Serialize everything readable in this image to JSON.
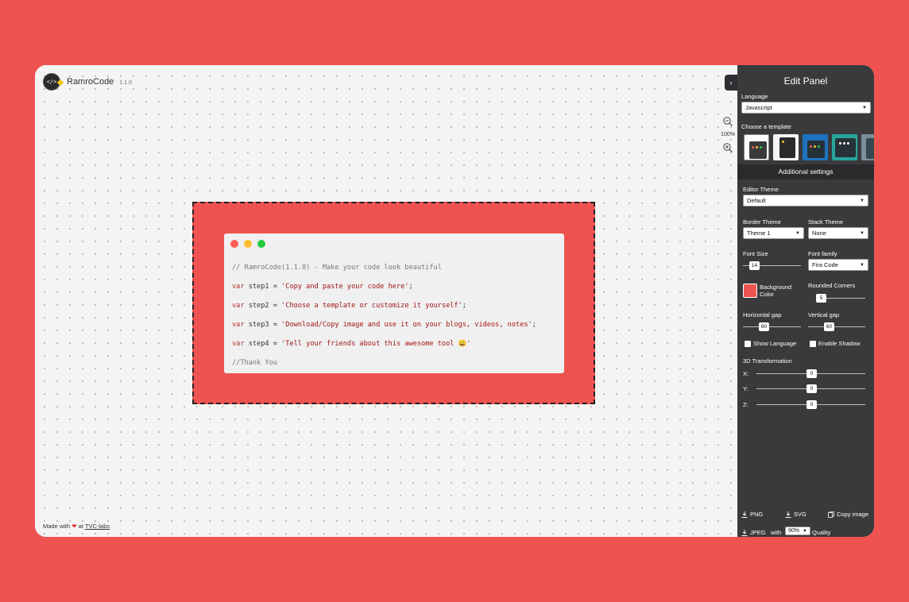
{
  "brand": {
    "name": "RamroCode",
    "version": "1.1.0",
    "logo_text": "</>"
  },
  "zoom": {
    "value": "100%"
  },
  "editor": {
    "dot_colors": [
      "#ff5f56",
      "#ffbd2e",
      "#27c93f"
    ],
    "lines": [
      {
        "kind": "comment",
        "text": "// RamroCode(1.1.0) - Make your code look beautiful"
      },
      {
        "kind": "code",
        "kw": "var",
        "rest": " step1 = ",
        "str": "'Copy and paste your code here'",
        "end": ";"
      },
      {
        "kind": "code",
        "kw": "var",
        "rest": " step2 = ",
        "str": "'Choose a template or customize it yourself'",
        "end": ";"
      },
      {
        "kind": "code",
        "kw": "var",
        "rest": " step3 = ",
        "str": "'Download/Copy image and use it on your blogs, videos, notes'",
        "end": ";"
      },
      {
        "kind": "code",
        "kw": "var",
        "rest": " step4 = ",
        "str": "'Tell your friends about this awesome tool 😀'",
        "end": ""
      },
      {
        "kind": "comment",
        "text": "//Thank You"
      }
    ]
  },
  "footer": {
    "made_with": "Made with",
    "at": "at",
    "link": "TVC-labs"
  },
  "panel": {
    "title": "Edit Panel",
    "language_label": "Language",
    "language_value": "Javascript",
    "template_label": "Choose a template",
    "additional_label": "Additional settings",
    "editor_theme_label": "Editor Theme",
    "editor_theme_value": "Default",
    "border_theme_label": "Border Theme",
    "border_theme_value": "Theme 1",
    "stack_theme_label": "Stack Theme",
    "stack_theme_value": "None",
    "font_size_label": "Font Size",
    "font_size_value": "14",
    "font_family_label": "Font family",
    "font_family_value": "Fira Code",
    "bg_color_label": "Background Color",
    "bg_color": "#ef5350",
    "rounded_label": "Rounded Corners",
    "rounded_value": "5",
    "hgap_label": "Horizontal gap",
    "hgap_value": "60",
    "vgap_label": "Vertical gap",
    "vgap_value": "60",
    "show_language_label": "Show Language",
    "enable_shadow_label": "Enable Shadow",
    "transform_label": "3D Transformation",
    "x_label": "X:",
    "x_value": "0",
    "y_label": "Y:",
    "y_value": "0",
    "z_label": "Z:",
    "z_value": "0",
    "png_label": "PNG",
    "svg_label": "SVG",
    "copy_label": "Copy image",
    "jpeg_label": "JPEG",
    "with_label": "with",
    "quality_value": "90%",
    "quality_label": "Quality"
  },
  "colors": {
    "accent": "#ef5350",
    "panel": "#3a3a3d"
  }
}
